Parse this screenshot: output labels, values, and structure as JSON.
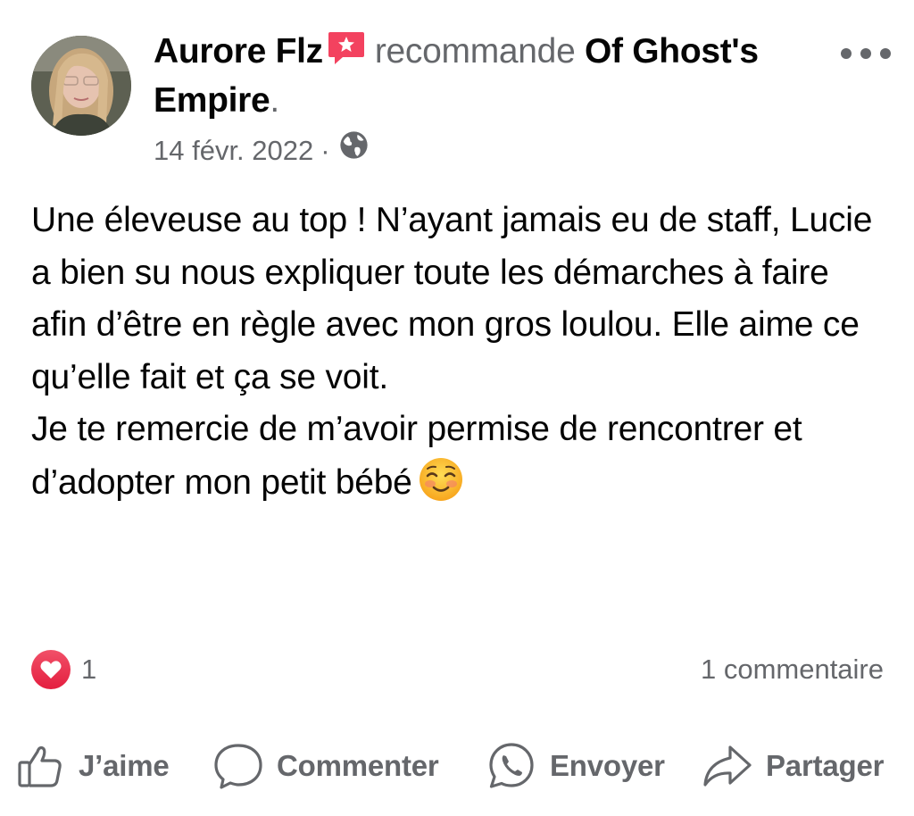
{
  "post": {
    "author": "Aurore Flz",
    "verb": "recommande",
    "page_name": "Of Ghost's Empire",
    "period": ".",
    "date": "14 févr. 2022",
    "separator": "·",
    "privacy_icon": "globe-icon",
    "more_icon": "more-options-icon",
    "body_lines": [
      "Une éleveuse au top ! N’ayant jamais eu de staff, Lucie a bien su nous expliquer toute les démarches à faire afin d’être en règle avec mon gros loulou. Elle aime ce qu’elle fait et ça se voit.",
      "Je te remercie de m’avoir permise de rencontrer et d’adopter mon petit bébé"
    ],
    "emoji": "smiling-face-icon"
  },
  "stats": {
    "reaction_icon": "heart-icon",
    "reaction_count": "1",
    "comments": "1 commentaire"
  },
  "actions": {
    "like": "J’aime",
    "comment": "Commenter",
    "send": "Envoyer",
    "share": "Partager"
  },
  "colors": {
    "text": "#050505",
    "secondary": "#65676b",
    "recommend_badge": "#f3425f",
    "heart_badge": "#e41e3f"
  }
}
